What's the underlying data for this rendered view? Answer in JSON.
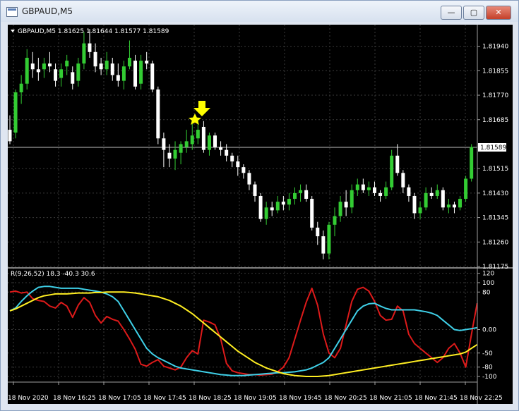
{
  "window": {
    "title": "GBPAUD,M5",
    "close_label": "✕",
    "max_label": "▢",
    "min_label": "—"
  },
  "colors": {
    "background": "#000000",
    "bull": "#33cc33",
    "bear": "#ffffff",
    "grid": "#3a3a3a",
    "text": "#ffffff",
    "arrow": "#ffff00",
    "price_line": "#c0c0c0",
    "ind_red": "#dd1a1a",
    "ind_cyan": "#3fd0e8",
    "ind_yellow": "#ffee22"
  },
  "main_chart": {
    "header": "GBPAUD,M5  1.81625 1.81644 1.81577 1.81589",
    "current_price_label": "1.81589",
    "current_price": 1.81589,
    "price_ticks": [
      "1.81940",
      "1.81855",
      "1.81770",
      "1.81685",
      "1.81515",
      "1.81430",
      "1.81345",
      "1.81260",
      "1.81175"
    ],
    "price_range": [
      1.81175,
      1.82015
    ]
  },
  "indicator": {
    "header": "R(9,26,52) 18.3 -40.3 30.6",
    "ticks": [
      "120",
      "100",
      "80",
      "0.00",
      "-50",
      "-80",
      "-100"
    ],
    "range": [
      -112,
      130
    ]
  },
  "time_labels": [
    "18 Nov 2020",
    "18 Nov 16:25",
    "18 Nov 17:05",
    "18 Nov 17:45",
    "18 Nov 18:25",
    "18 Nov 19:05",
    "18 Nov 19:45",
    "18 Nov 20:25",
    "18 Nov 21:05",
    "18 Nov 21:45",
    "18 Nov 22:25"
  ],
  "chart_data": {
    "type": "candlestick",
    "series": [
      {
        "name": "GBPAUD,M5",
        "ohlc": [
          [
            1.8165,
            1.817,
            1.816,
            1.8161
          ],
          [
            1.8164,
            1.8179,
            1.8162,
            1.8178
          ],
          [
            1.8178,
            1.8184,
            1.8174,
            1.8181
          ],
          [
            1.8181,
            1.8193,
            1.8179,
            1.819
          ],
          [
            1.8188,
            1.8192,
            1.8183,
            1.8186
          ],
          [
            1.8186,
            1.819,
            1.8182,
            1.8185
          ],
          [
            1.8186,
            1.819,
            1.8183,
            1.8188
          ],
          [
            1.8188,
            1.8192,
            1.8185,
            1.8187
          ],
          [
            1.8186,
            1.8188,
            1.818,
            1.8182
          ],
          [
            1.8183,
            1.8188,
            1.818,
            1.8186
          ],
          [
            1.8187,
            1.8191,
            1.8184,
            1.8189
          ],
          [
            1.8185,
            1.8187,
            1.8179,
            1.8181
          ],
          [
            1.8182,
            1.819,
            1.818,
            1.8188
          ],
          [
            1.8188,
            1.8199,
            1.8186,
            1.8195
          ],
          [
            1.8195,
            1.82,
            1.819,
            1.8192
          ],
          [
            1.8192,
            1.8195,
            1.8185,
            1.8187
          ],
          [
            1.8188,
            1.819,
            1.8184,
            1.8186
          ],
          [
            1.8186,
            1.8192,
            1.8184,
            1.8189
          ],
          [
            1.8188,
            1.819,
            1.8182,
            1.8184
          ],
          [
            1.8184,
            1.8188,
            1.818,
            1.8182
          ],
          [
            1.8182,
            1.8189,
            1.8179,
            1.8187
          ],
          [
            1.8187,
            1.8196,
            1.8186,
            1.819
          ],
          [
            1.8189,
            1.8191,
            1.8179,
            1.818
          ],
          [
            1.8181,
            1.8191,
            1.8179,
            1.8189
          ],
          [
            1.8189,
            1.8192,
            1.8186,
            1.8188
          ],
          [
            1.8188,
            1.8189,
            1.8178,
            1.8179
          ],
          [
            1.8179,
            1.818,
            1.816,
            1.8162
          ],
          [
            1.8162,
            1.8164,
            1.8152,
            1.8158
          ],
          [
            1.8157,
            1.816,
            1.8152,
            1.8155
          ],
          [
            1.8155,
            1.8161,
            1.8151,
            1.8158
          ],
          [
            1.8157,
            1.8161,
            1.8153,
            1.816
          ],
          [
            1.8159,
            1.8165,
            1.8157,
            1.8161
          ],
          [
            1.816,
            1.8167,
            1.8158,
            1.8163
          ],
          [
            1.8162,
            1.8169,
            1.816,
            1.8165
          ],
          [
            1.8166,
            1.8168,
            1.8157,
            1.8158
          ],
          [
            1.8158,
            1.8164,
            1.8156,
            1.8163
          ],
          [
            1.8163,
            1.8164,
            1.8158,
            1.8159
          ],
          [
            1.8159,
            1.8161,
            1.8156,
            1.8158
          ],
          [
            1.8158,
            1.816,
            1.8154,
            1.8156
          ],
          [
            1.8156,
            1.8157,
            1.8152,
            1.8154
          ],
          [
            1.8154,
            1.8156,
            1.8149,
            1.8152
          ],
          [
            1.8152,
            1.8153,
            1.8148,
            1.815
          ],
          [
            1.815,
            1.8151,
            1.8144,
            1.8146
          ],
          [
            1.8146,
            1.8147,
            1.814,
            1.8142
          ],
          [
            1.8142,
            1.8143,
            1.8133,
            1.8134
          ],
          [
            1.8134,
            1.814,
            1.8132,
            1.8138
          ],
          [
            1.8138,
            1.814,
            1.8135,
            1.8137
          ],
          [
            1.8137,
            1.8142,
            1.8136,
            1.814
          ],
          [
            1.814,
            1.8142,
            1.8137,
            1.8139
          ],
          [
            1.8139,
            1.8143,
            1.8137,
            1.8141
          ],
          [
            1.8141,
            1.8145,
            1.8139,
            1.8143
          ],
          [
            1.8143,
            1.8146,
            1.814,
            1.8144
          ],
          [
            1.8144,
            1.8146,
            1.814,
            1.8141
          ],
          [
            1.8141,
            1.8142,
            1.813,
            1.8131
          ],
          [
            1.8131,
            1.8133,
            1.8125,
            1.8128
          ],
          [
            1.8128,
            1.813,
            1.812,
            1.8122
          ],
          [
            1.8122,
            1.8133,
            1.812,
            1.8132
          ],
          [
            1.8132,
            1.8138,
            1.8128,
            1.8135
          ],
          [
            1.8135,
            1.8142,
            1.8133,
            1.814
          ],
          [
            1.814,
            1.8144,
            1.8135,
            1.8138
          ],
          [
            1.8138,
            1.8146,
            1.8136,
            1.8144
          ],
          [
            1.8144,
            1.8148,
            1.8142,
            1.8146
          ],
          [
            1.8146,
            1.8148,
            1.8143,
            1.8144
          ],
          [
            1.8144,
            1.8147,
            1.8142,
            1.8145
          ],
          [
            1.8145,
            1.8147,
            1.8142,
            1.8143
          ],
          [
            1.8143,
            1.8144,
            1.814,
            1.8142
          ],
          [
            1.8142,
            1.8147,
            1.8141,
            1.8145
          ],
          [
            1.8145,
            1.8158,
            1.8144,
            1.8156
          ],
          [
            1.8156,
            1.816,
            1.8149,
            1.815
          ],
          [
            1.815,
            1.8151,
            1.8143,
            1.8145
          ],
          [
            1.8145,
            1.8146,
            1.814,
            1.8142
          ],
          [
            1.8142,
            1.8143,
            1.8134,
            1.8136
          ],
          [
            1.8136,
            1.814,
            1.8134,
            1.8138
          ],
          [
            1.8138,
            1.8145,
            1.8137,
            1.8143
          ],
          [
            1.8143,
            1.8145,
            1.8141,
            1.8142
          ],
          [
            1.8142,
            1.8146,
            1.8141,
            1.8144
          ],
          [
            1.8144,
            1.8145,
            1.8137,
            1.8138
          ],
          [
            1.8138,
            1.8141,
            1.8136,
            1.8139
          ],
          [
            1.8139,
            1.814,
            1.8136,
            1.8138
          ],
          [
            1.8138,
            1.8142,
            1.8137,
            1.8141
          ],
          [
            1.8141,
            1.8149,
            1.814,
            1.8148
          ],
          [
            1.8148,
            1.816,
            1.8147,
            1.8159
          ]
        ]
      }
    ],
    "signal_arrow_bar": 33,
    "indicator_series": [
      {
        "color": "ind_red",
        "values": [
          80,
          82,
          78,
          80,
          66,
          62,
          60,
          50,
          46,
          58,
          50,
          26,
          52,
          68,
          58,
          30,
          14,
          28,
          22,
          18,
          0,
          -20,
          -42,
          -74,
          -78,
          -70,
          -64,
          -78,
          -82,
          -86,
          -80,
          -60,
          -45,
          -52,
          20,
          16,
          10,
          -20,
          -72,
          -88,
          -92,
          -94,
          -96,
          -96,
          -97,
          -96,
          -95,
          -90,
          -80,
          -60,
          -20,
          20,
          58,
          88,
          52,
          -10,
          -50,
          -60,
          -40,
          10,
          60,
          86,
          90,
          82,
          60,
          30,
          20,
          22,
          50,
          40,
          -10,
          -30,
          -40,
          -50,
          -60,
          -70,
          -60,
          -40,
          -30,
          -50,
          -80,
          -10,
          56
        ]
      },
      {
        "color": "ind_cyan",
        "values": [
          40,
          46,
          60,
          72,
          82,
          90,
          92,
          92,
          90,
          88,
          88,
          88,
          88,
          86,
          84,
          82,
          80,
          76,
          70,
          60,
          40,
          20,
          0,
          -20,
          -40,
          -52,
          -60,
          -66,
          -72,
          -78,
          -82,
          -84,
          -86,
          -88,
          -90,
          -92,
          -94,
          -96,
          -97,
          -98,
          -98,
          -98,
          -97,
          -96,
          -95,
          -94,
          -93,
          -92,
          -92,
          -91,
          -90,
          -88,
          -86,
          -82,
          -76,
          -70,
          -60,
          -40,
          -20,
          0,
          20,
          40,
          50,
          55,
          56,
          50,
          45,
          42,
          42,
          42,
          42,
          42,
          40,
          38,
          35,
          30,
          20,
          10,
          0,
          -2,
          0,
          2,
          4
        ]
      },
      {
        "color": "ind_yellow",
        "values": [
          40,
          44,
          50,
          56,
          62,
          68,
          72,
          74,
          76,
          76,
          76,
          77,
          78,
          78,
          78,
          79,
          79,
          80,
          80,
          80,
          80,
          79,
          78,
          76,
          74,
          72,
          70,
          66,
          62,
          56,
          50,
          42,
          34,
          24,
          14,
          4,
          -6,
          -16,
          -26,
          -36,
          -46,
          -54,
          -62,
          -70,
          -76,
          -82,
          -86,
          -90,
          -94,
          -96,
          -98,
          -99,
          -100,
          -100,
          -100,
          -99,
          -98,
          -96,
          -94,
          -92,
          -90,
          -88,
          -86,
          -84,
          -82,
          -80,
          -78,
          -76,
          -74,
          -72,
          -70,
          -68,
          -66,
          -64,
          -62,
          -60,
          -58,
          -56,
          -54,
          -52,
          -48,
          -40,
          -32
        ]
      }
    ]
  }
}
